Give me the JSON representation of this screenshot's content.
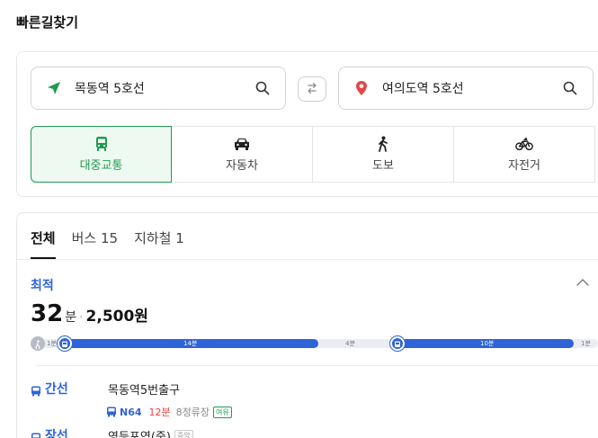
{
  "page": {
    "title": "빠른길찾기"
  },
  "search": {
    "origin": "목동역 5호선",
    "destination": "여의도역 5호선"
  },
  "modes": [
    {
      "label": "대중교통",
      "icon": "bus-icon",
      "active": true
    },
    {
      "label": "자동차",
      "icon": "car-icon",
      "active": false
    },
    {
      "label": "도보",
      "icon": "walk-icon",
      "active": false
    },
    {
      "label": "자전거",
      "icon": "bicycle-icon",
      "active": false
    }
  ],
  "tabs": [
    {
      "label": "전체",
      "active": true
    },
    {
      "label": "버스 15",
      "active": false
    },
    {
      "label": "지하철 1",
      "active": false
    }
  ],
  "result": {
    "label": "최적",
    "time": "32",
    "time_unit": "분",
    "separator": "·",
    "fare": "2,500원",
    "timeline": [
      {
        "type": "walk",
        "label": "1분"
      },
      {
        "type": "bus",
        "label": "14분"
      },
      {
        "type": "walk",
        "label": "4분"
      },
      {
        "type": "bus",
        "label": "10분"
      },
      {
        "type": "walk",
        "label": "1분"
      }
    ],
    "legs": [
      {
        "type": "간선",
        "stop": "목동역5번출구"
      },
      {
        "type": "장선",
        "stop": "영등포역(중)",
        "badge": "증앙"
      }
    ],
    "bus": {
      "number": "N64",
      "minutes": "12분",
      "stops": "8정류장",
      "badge": "여유"
    }
  },
  "colors": {
    "accent_green": "#1e9b52",
    "accent_blue": "#2f63d8",
    "alert_red": "#e64545"
  }
}
